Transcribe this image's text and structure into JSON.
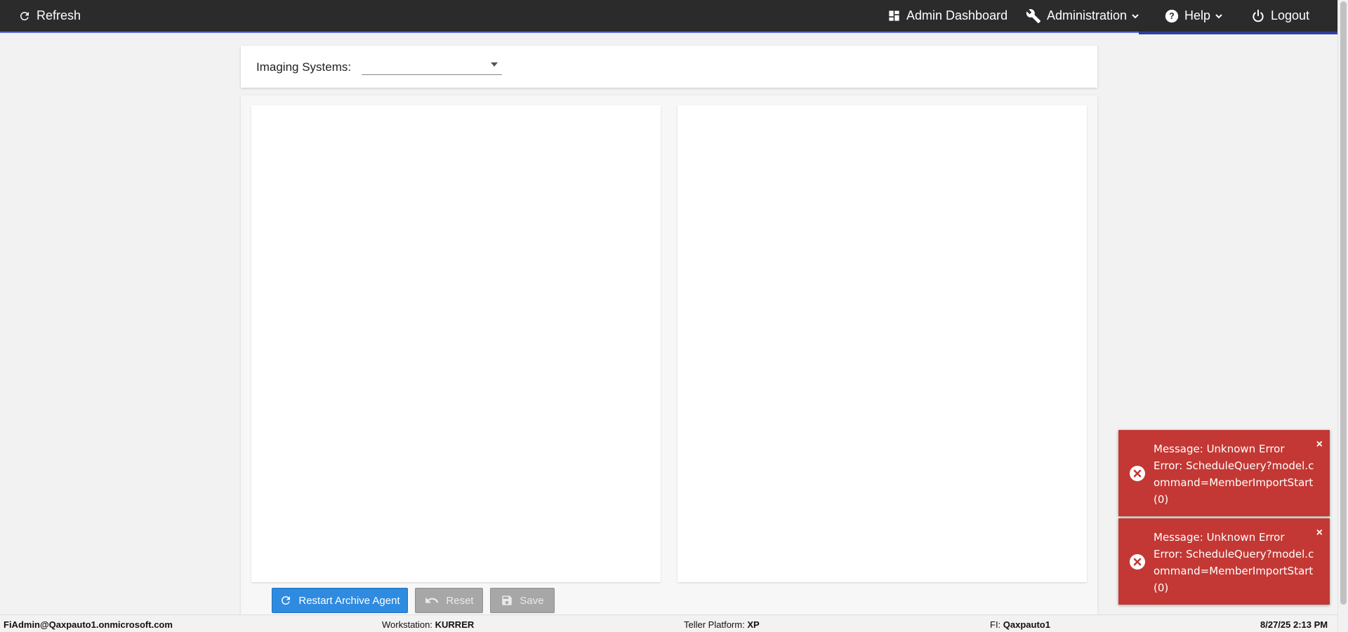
{
  "nav": {
    "refresh": "Refresh",
    "admin_dashboard": "Admin Dashboard",
    "administration": "Administration",
    "help": "Help",
    "logout": "Logout"
  },
  "imaging": {
    "label": "Imaging Systems:",
    "selected": ""
  },
  "buttons": {
    "restart": "Restart Archive Agent",
    "reset": "Reset",
    "save": "Save"
  },
  "toasts": [
    {
      "line1": "Message: Unknown Error",
      "line2": "Error: ScheduleQuery?model.command=MemberImportStart (0)",
      "close": "×"
    },
    {
      "line1": "Message: Unknown Error",
      "line2": "Error: ScheduleQuery?model.command=MemberImportStart (0)",
      "close": "×"
    }
  ],
  "status": {
    "user": "FiAdmin@Qaxpauto1.onmicrosoft.com",
    "workstation_label": "Workstation:",
    "workstation": "KURRER",
    "platform_label": "Teller Platform:",
    "platform": "XP",
    "fi_label": "FI:",
    "fi": "Qaxpauto1",
    "datetime": "8/27/25 2:13 PM"
  },
  "colors": {
    "topbar": "#2b2b2b",
    "primary_button": "#2f8be0",
    "error_toast": "#c33834"
  }
}
